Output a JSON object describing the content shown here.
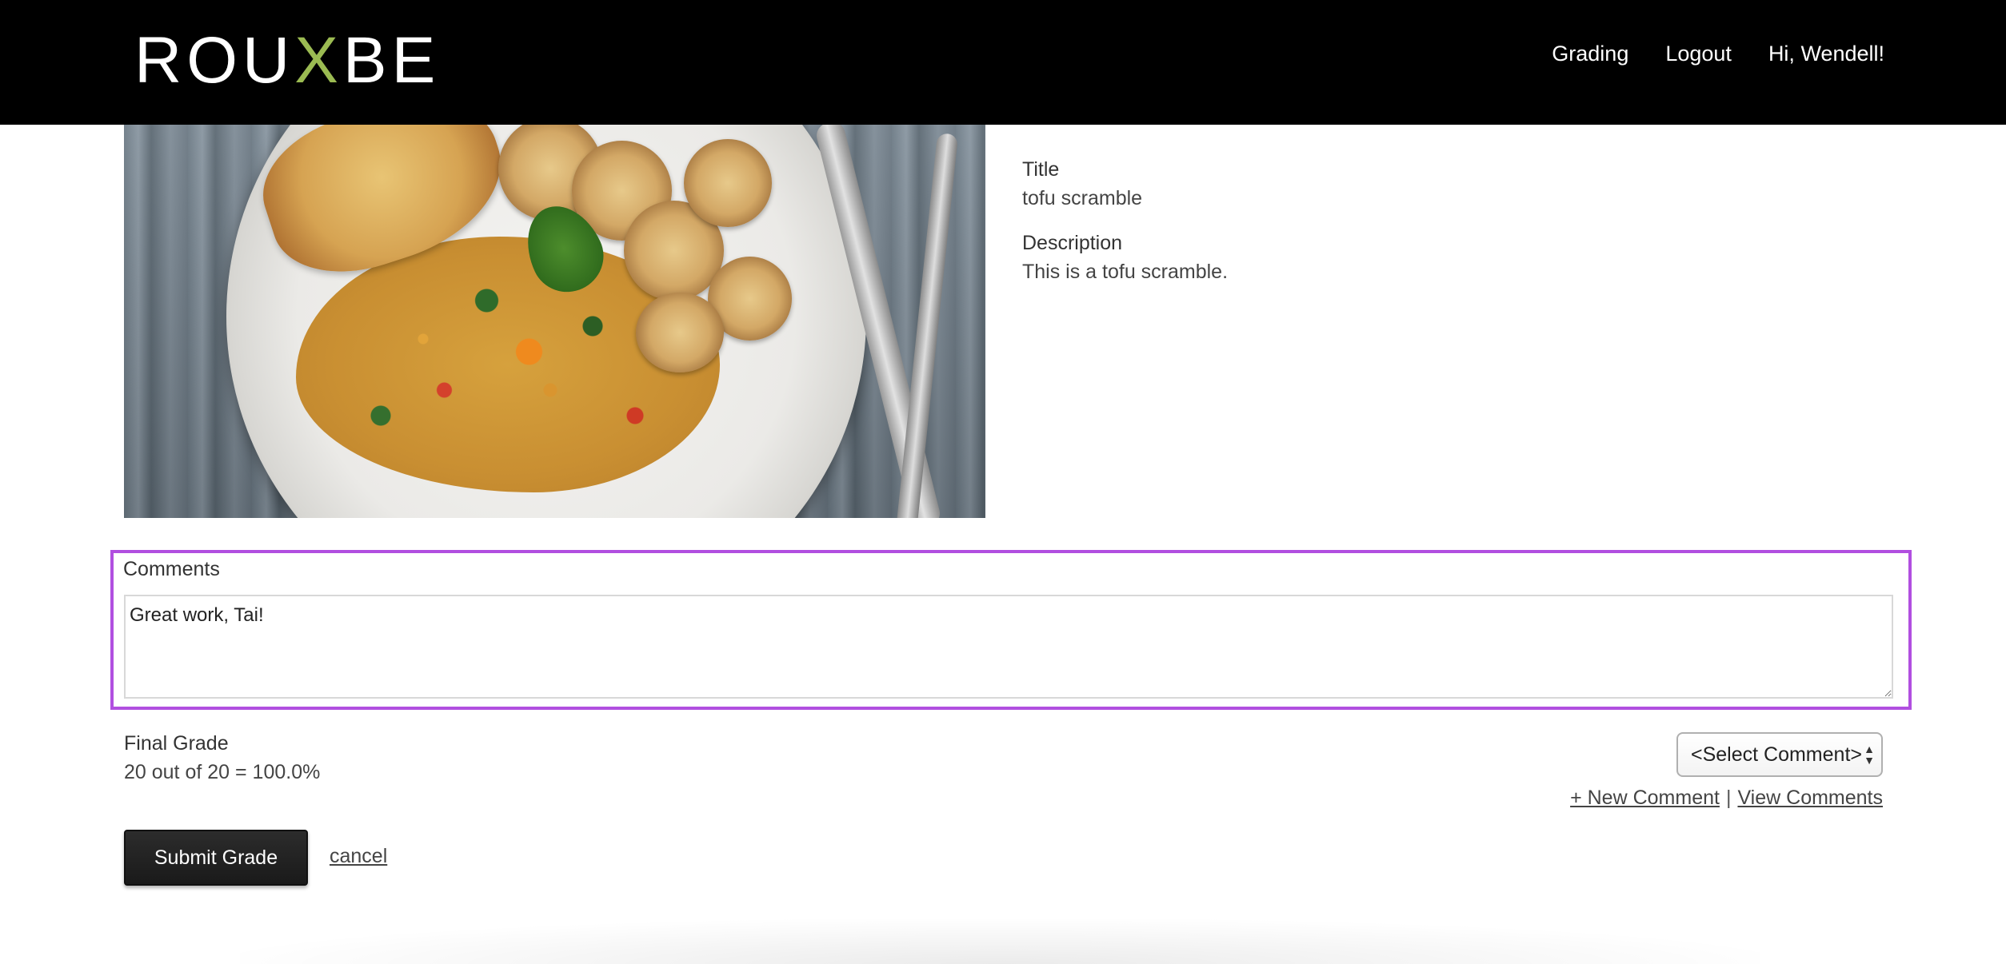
{
  "header": {
    "logo_text_left": "ROU",
    "logo_text_x": "X",
    "logo_text_right": "BE",
    "nav": {
      "grading": "Grading",
      "logout": "Logout",
      "greeting": "Hi, Wendell!"
    }
  },
  "submission": {
    "title_label": "Title",
    "title_value": "tofu scramble",
    "description_label": "Description",
    "description_value": "This is a tofu scramble."
  },
  "comments": {
    "label": "Comments",
    "value": "Great work, Tai!"
  },
  "grade": {
    "label": "Final Grade",
    "value": "20 out of 20 = 100.0%"
  },
  "comment_tools": {
    "select_value": "<Select Comment>",
    "new_comment": "+ New Comment",
    "separator": "|",
    "view_comments": "View Comments"
  },
  "actions": {
    "submit": "Submit Grade",
    "cancel": "cancel"
  },
  "colors": {
    "header_bg": "#000000",
    "logo_accent": "#9bbb52",
    "highlight_border": "#b14fe0"
  }
}
